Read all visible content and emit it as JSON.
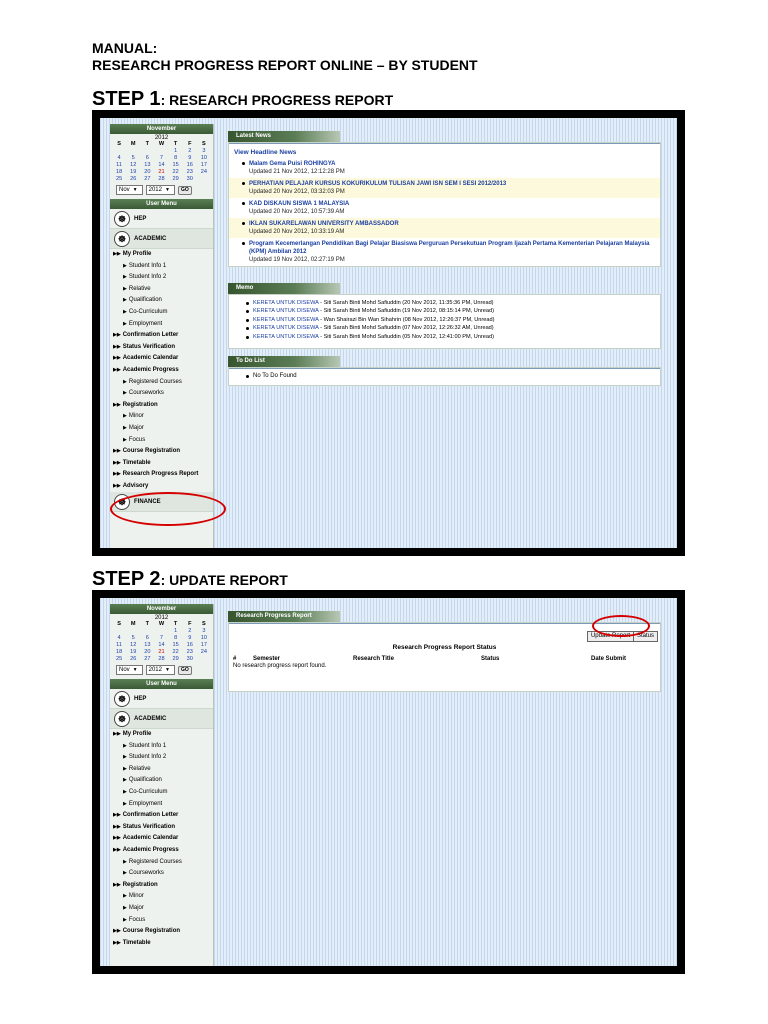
{
  "doc": {
    "line1": "MANUAL:",
    "line2": "RESEARCH PROGRESS REPORT ONLINE – BY STUDENT",
    "step1": {
      "num": "STEP 1",
      "title": ": RESEARCH PROGRESS REPORT"
    },
    "step2": {
      "num": "STEP 2",
      "title": ": UPDATE REPORT"
    }
  },
  "calendar": {
    "month": "November",
    "year": "2012",
    "day_names": [
      "S",
      "M",
      "T",
      "W",
      "T",
      "F",
      "S"
    ],
    "weeks": [
      [
        "",
        "",
        "",
        "",
        "1",
        "2",
        "3"
      ],
      [
        "4",
        "5",
        "6",
        "7",
        "8",
        "9",
        "10"
      ],
      [
        "11",
        "12",
        "13",
        "14",
        "15",
        "16",
        "17"
      ],
      [
        "18",
        "19",
        "20",
        "21",
        "22",
        "23",
        "24"
      ],
      [
        "25",
        "26",
        "27",
        "28",
        "29",
        "30",
        ""
      ]
    ],
    "highlight": "21",
    "month_select": "Nov",
    "year_select": "2012",
    "go_label": "GO"
  },
  "user_menu": {
    "title": "User Menu",
    "hep": "HEP",
    "academic": "ACADEMIC",
    "finance": "FINANCE",
    "items": [
      {
        "label": "My Profile",
        "level": "top"
      },
      {
        "label": "Student Info 1",
        "level": "sub"
      },
      {
        "label": "Student Info 2",
        "level": "sub"
      },
      {
        "label": "Relative",
        "level": "sub"
      },
      {
        "label": "Qualification",
        "level": "sub"
      },
      {
        "label": "Co-Curriculum",
        "level": "sub"
      },
      {
        "label": "Employment",
        "level": "sub"
      },
      {
        "label": "Confirmation Letter",
        "level": "top"
      },
      {
        "label": "Status Verification",
        "level": "top"
      },
      {
        "label": "Academic Calendar",
        "level": "top"
      },
      {
        "label": "Academic Progress",
        "level": "top"
      },
      {
        "label": "Registered Courses",
        "level": "sub"
      },
      {
        "label": "Courseworks",
        "level": "sub"
      },
      {
        "label": "Registration",
        "level": "top"
      },
      {
        "label": "Minor",
        "level": "sub"
      },
      {
        "label": "Major",
        "level": "sub"
      },
      {
        "label": "Focus",
        "level": "sub"
      },
      {
        "label": "Course Registration",
        "level": "top"
      },
      {
        "label": "Timetable",
        "level": "top"
      },
      {
        "label": "Research Progress Report",
        "level": "top"
      },
      {
        "label": "Advisory",
        "level": "top"
      }
    ]
  },
  "news": {
    "tab": "Latest News",
    "headline_link": "View Headline News",
    "items": [
      {
        "title": "Malam Gema Puisi ROHINGYA",
        "updated": "Updated 21 Nov 2012, 12:12:28 PM"
      },
      {
        "title": "PERHATIAN PELAJAR KURSUS KOKURIKULUM TULISAN JAWI ISN SEM I SESI 2012/2013",
        "updated": "Updated 20 Nov 2012, 03:32:03 PM"
      },
      {
        "title": "KAD DISKAUN SISWA 1 MALAYSIA",
        "updated": "Updated 20 Nov 2012, 10:57:39 AM"
      },
      {
        "title": "IKLAN SUKARELAWAN UNIVERSITY AMBASSADOR",
        "updated": "Updated 20 Nov 2012, 10:33:19 AM"
      },
      {
        "title": "Program Kecemerlangan Pendidikan Bagi Pelajar Biasiswa Perguruan Persekutuan Program Ijazah Pertama Kementerian Pelajaran Malaysia (KPM) Ambilan 2012",
        "updated": "Updated 19 Nov 2012, 02:27:19 PM"
      }
    ]
  },
  "memo": {
    "tab": "Memo",
    "items": [
      {
        "link": "KERETA UNTUK DISEWA",
        "rest": " - Siti Sarah Binti Mohd Safiuddin (20 Nov 2012, 11:35:36 PM, Unread)"
      },
      {
        "link": "KERETA UNTUK DISEWA",
        "rest": " - Siti Sarah Binti Mohd Safiuddin (19 Nov 2012, 08:15:14 PM, Unread)"
      },
      {
        "link": "KERETA UNTUK DISEWA",
        "rest": " - Wan Shairazi Bin Wan Sihahrin (08 Nov 2012, 12:26:37 PM, Unread)"
      },
      {
        "link": "KERETA UNTUK DISEWA",
        "rest": " - Siti Sarah Binti Mohd Safiuddin (07 Nov 2012, 12:26:32 AM, Unread)"
      },
      {
        "link": "KERETA UNTUK DISEWA",
        "rest": " - Siti Sarah Binti Mohd Safiuddin (05 Nov 2012, 12:41:00 PM, Unread)"
      }
    ]
  },
  "todo": {
    "tab": "To Do List",
    "empty": "No To Do Found"
  },
  "report": {
    "tab": "Research Progress Report",
    "update_button": "Update Report",
    "status_button": "Status",
    "table_title": "Research Progress Report Status",
    "columns": [
      "#",
      "Semester",
      "Research Title",
      "Status",
      "Date Submit"
    ],
    "empty": "No research progress report found."
  }
}
